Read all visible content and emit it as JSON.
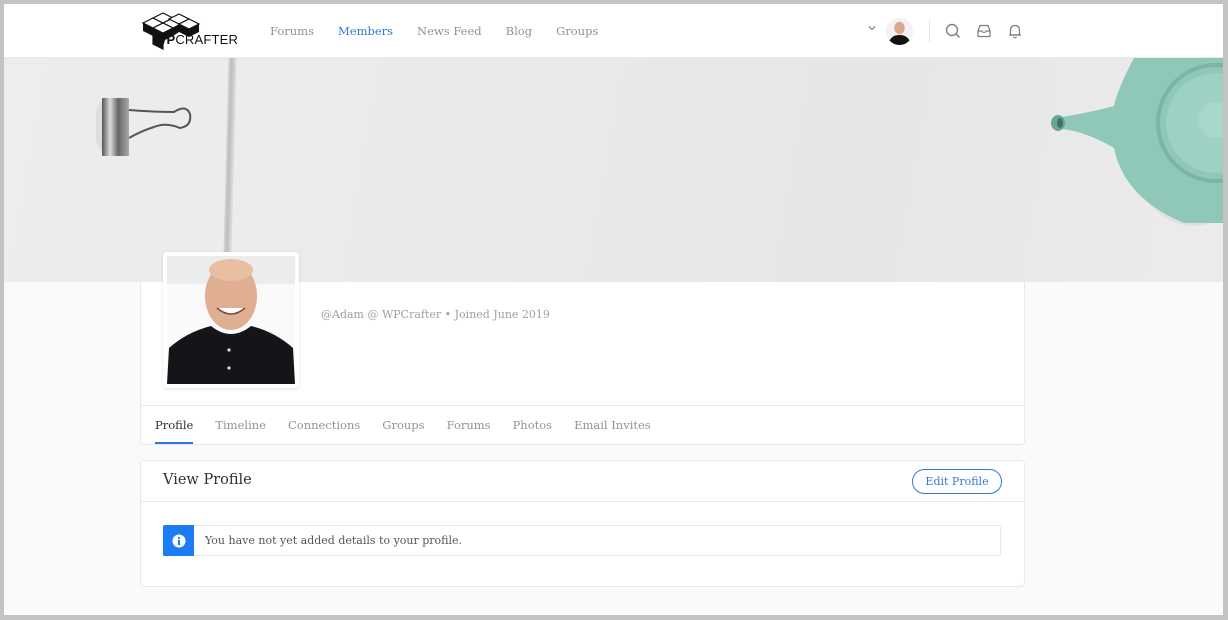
{
  "header": {
    "logo": {
      "prefix": "WP",
      "suffix": "CRAFTER"
    },
    "nav": [
      {
        "label": "Forums",
        "active": false
      },
      {
        "label": "Members",
        "active": true
      },
      {
        "label": "News Feed",
        "active": false
      },
      {
        "label": "Blog",
        "active": false
      },
      {
        "label": "Groups",
        "active": false
      }
    ],
    "icons": [
      "chevron-down-icon",
      "search-icon",
      "inbox-icon",
      "bell-icon"
    ]
  },
  "profile": {
    "meta": "@Adam @ WPCrafter • Joined June 2019",
    "tabs": [
      {
        "label": "Profile",
        "active": true
      },
      {
        "label": "Timeline",
        "active": false
      },
      {
        "label": "Connections",
        "active": false
      },
      {
        "label": "Groups",
        "active": false
      },
      {
        "label": "Forums",
        "active": false
      },
      {
        "label": "Photos",
        "active": false
      },
      {
        "label": "Email Invites",
        "active": false
      }
    ]
  },
  "view_profile": {
    "title": "View Profile",
    "edit_label": "Edit Profile",
    "notice": "You have not yet added details to your profile.",
    "notice_icon": "info-icon"
  },
  "colors": {
    "accent": "#2f7ad6",
    "info": "#1b7cf3"
  }
}
